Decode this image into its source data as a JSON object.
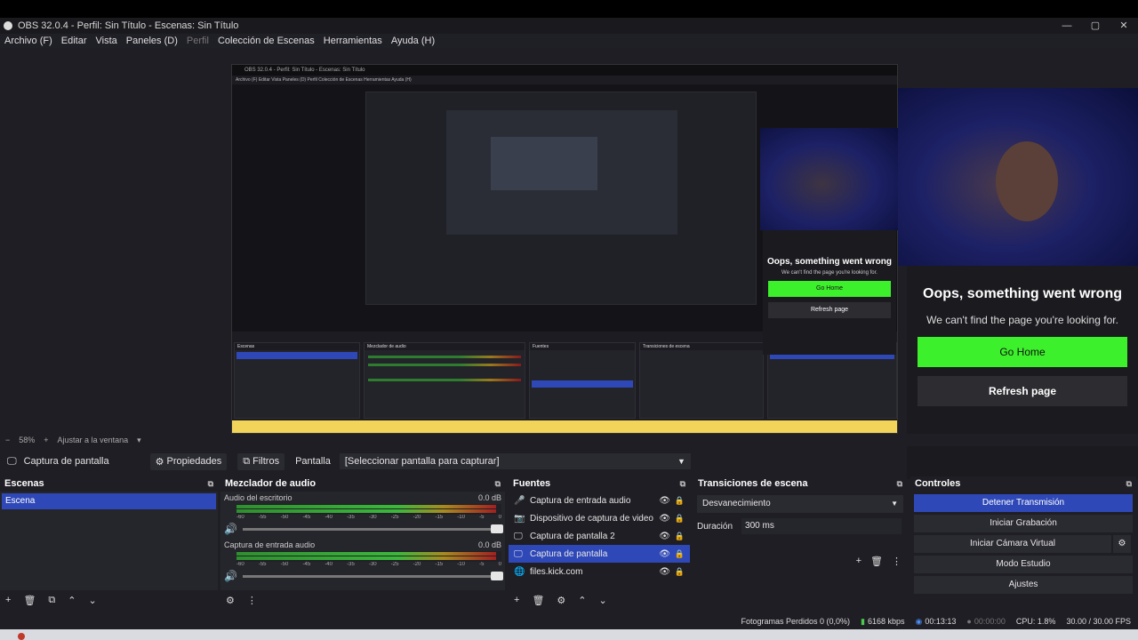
{
  "window": {
    "title": "OBS 32.0.4 - Perfil: Sin Título - Escenas: Sin Título",
    "controls": [
      "—",
      "▢",
      "✕"
    ]
  },
  "menu": [
    "Archivo (F)",
    "Editar",
    "Vista",
    "Paneles (D)",
    "Perfil",
    "Colección de Escenas",
    "Herramientas",
    "Ayuda (H)"
  ],
  "preview": {
    "nested_title": "OBS 32.0.4 - Perfil: Sin Título - Escenas: Sin Título",
    "nested_menu": "Archivo (F)  Editar  Vista  Paneles (D)  Perfil  Colección de Escenas  Herramientas  Ayuda (H)",
    "webcam_label": "webcam-feed",
    "error_page": {
      "title": "Oops, something went wrong",
      "message": "We can't find the page you're looking for.",
      "go_home": "Go Home",
      "refresh": "Refresh page"
    },
    "mini_error": {
      "title": "Oops, something went wrong",
      "message": "We can't find the page you're looking for.",
      "go_home": "Go Home",
      "refresh": "Refresh page"
    }
  },
  "zoom": {
    "minus": "−",
    "level": "58%",
    "plus": "+",
    "fit": "Ajustar a la ventana"
  },
  "sourcebar": {
    "source_name": "Captura de pantalla",
    "properties": "Propiedades",
    "filters": "Filtros",
    "screen_label": "Pantalla",
    "screen_value": "[Seleccionar pantalla para capturar]"
  },
  "scenes": {
    "title": "Escenas",
    "items": [
      "Escena"
    ]
  },
  "mixer": {
    "title": "Mezclador de audio",
    "channels": [
      {
        "name": "Audio del escritorio",
        "db": "0.0 dB",
        "level": 0.98
      },
      {
        "name": "Captura de entrada audio",
        "db": "0.0 dB",
        "level": 0.98
      }
    ],
    "ticks": [
      "-60",
      "-55",
      "-50",
      "-45",
      "-40",
      "-35",
      "-30",
      "-25",
      "-20",
      "-15",
      "-10",
      "-5",
      "0"
    ]
  },
  "sources": {
    "title": "Fuentes",
    "items": [
      {
        "icon": "🎤",
        "name": "Captura de entrada audio",
        "selected": false
      },
      {
        "icon": "📷",
        "name": "Dispositivo de captura de video",
        "selected": false
      },
      {
        "icon": "🖵",
        "name": "Captura de pantalla 2",
        "selected": false
      },
      {
        "icon": "🖵",
        "name": "Captura de pantalla",
        "selected": true
      },
      {
        "icon": "🌐",
        "name": "files.kick.com",
        "selected": false
      }
    ]
  },
  "transitions": {
    "title": "Transiciones de escena",
    "type": "Desvanecimiento",
    "duration_label": "Duración",
    "duration_value": "300 ms"
  },
  "controls": {
    "title": "Controles",
    "stop_stream": "Detener Transmisión",
    "start_record": "Iniciar Grabación",
    "virtual_cam": "Iniciar Cámara Virtual",
    "studio_mode": "Modo Estudio",
    "settings": "Ajustes"
  },
  "status": {
    "dropped_frames": "Fotogramas Perdidos 0 (0,0%)",
    "bitrate": "6168 kbps",
    "stream_time": "00:13:13",
    "record_time": "00:00:00",
    "cpu": "CPU: 1.8%",
    "fps": "30.00 / 30.00 FPS"
  },
  "colors": {
    "accent": "#2f48b8",
    "go_home": "#3df02c",
    "background": "#1e1e24"
  }
}
